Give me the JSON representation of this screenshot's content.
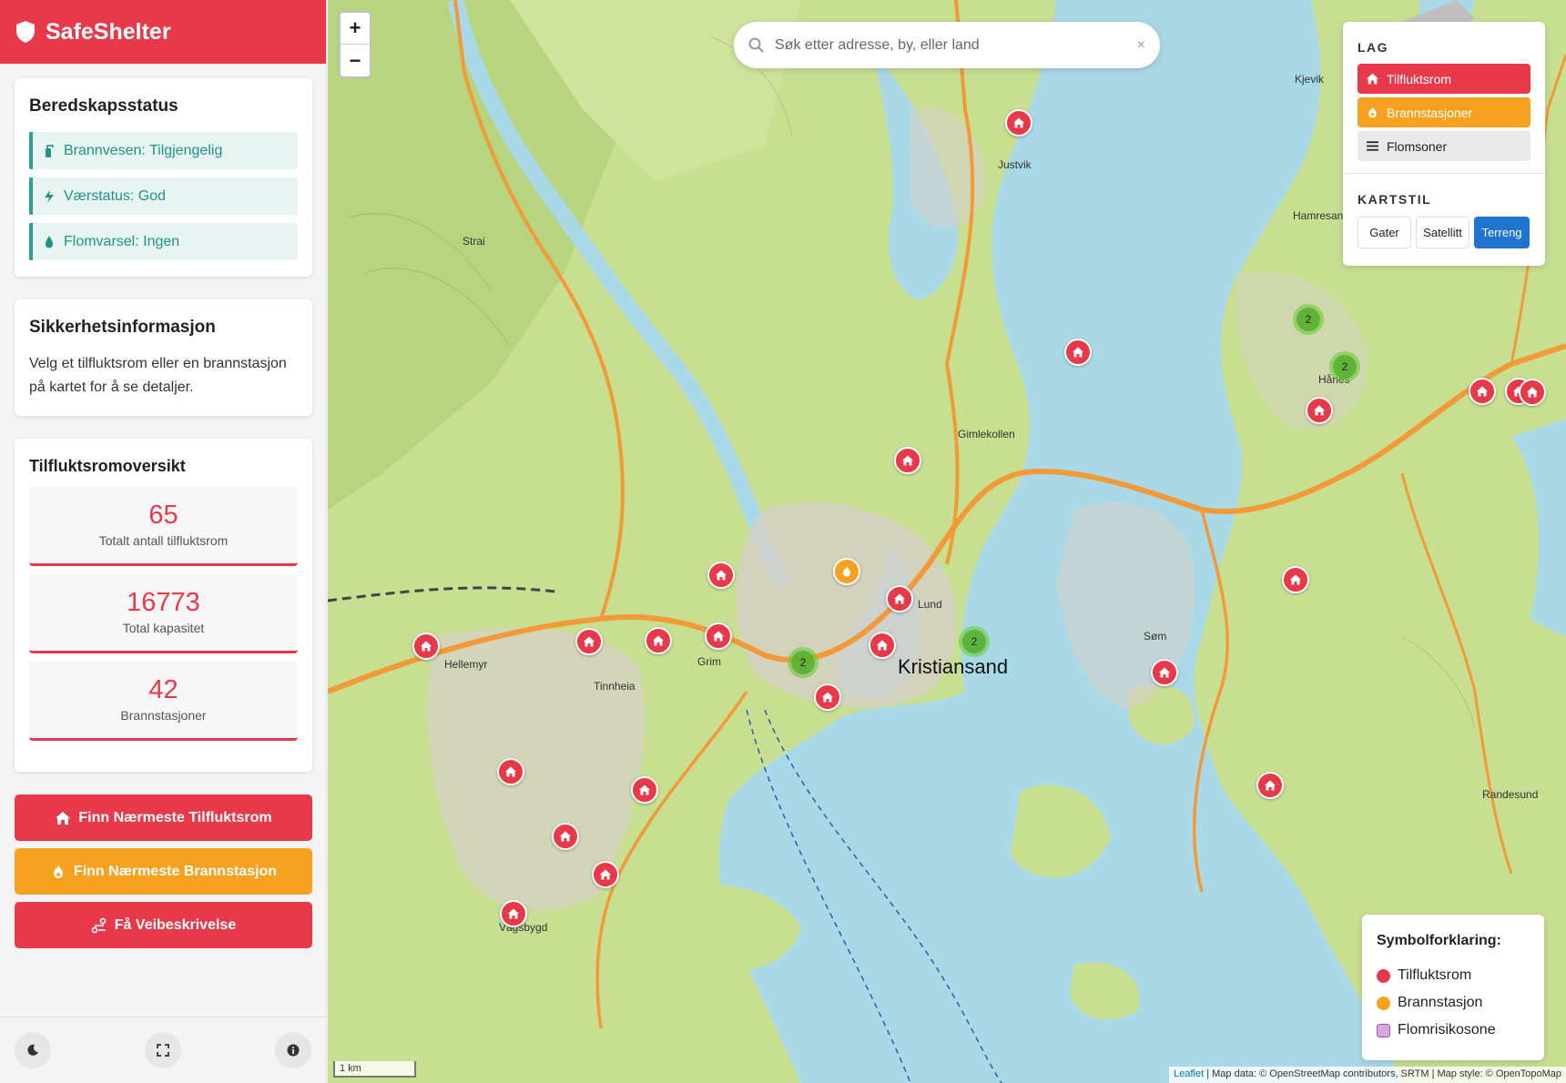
{
  "app": {
    "name": "SafeShelter"
  },
  "status": {
    "title": "Beredskapsstatus",
    "items": [
      {
        "icon": "fire-extinguisher-icon",
        "text": "Brannvesen: Tilgjengelig"
      },
      {
        "icon": "bolt-icon",
        "text": "Værstatus: God"
      },
      {
        "icon": "droplet-icon",
        "text": "Flomvarsel: Ingen"
      }
    ]
  },
  "info": {
    "title": "Sikkerhetsinformasjon",
    "text": "Velg et tilfluktsrom eller en brannstasjon på kartet for å se detaljer."
  },
  "overview": {
    "title": "Tilfluktsromoversikt",
    "stats": [
      {
        "value": "65",
        "label": "Totalt antall tilfluktsrom"
      },
      {
        "value": "16773",
        "label": "Total kapasitet"
      },
      {
        "value": "42",
        "label": "Brannstasjoner"
      }
    ]
  },
  "actions": {
    "shelter": "Finn Nærmeste Tilfluktsrom",
    "fire": "Finn Nærmeste Brannstasjon",
    "route": "Få Veibeskrivelse"
  },
  "footer": {
    "icons": [
      "moon-icon",
      "fullscreen-icon",
      "info-icon"
    ]
  },
  "map": {
    "zoom_in": "+",
    "zoom_out": "−",
    "search": {
      "placeholder": "Søk etter adresse, by, eller land",
      "clear": "×"
    },
    "layers": {
      "title": "LAG",
      "items": [
        "Tilfluktsrom",
        "Brannstasjoner",
        "Flomsoner"
      ],
      "style_title": "KARTSTIL",
      "styles": [
        "Gater",
        "Satellitt",
        "Terreng"
      ],
      "active_style": "Terreng"
    },
    "legend": {
      "title": "Symbolforklaring:",
      "items": [
        "Tilfluktsrom",
        "Brannstasjon",
        "Flomrisikosone"
      ]
    },
    "scale": "1 km",
    "attribution": {
      "leaflet": "Leaflet",
      "rest": " | Map data: © OpenStreetMap contributors, SRTM | Map style: © OpenTopoMap"
    },
    "places": [
      "Kristiansand",
      "Justvik",
      "Gimlekollen",
      "Lund",
      "Grim",
      "Hellemyr",
      "Tinnheia",
      "Vågsbygd",
      "Søm",
      "Hamresanden",
      "Kjevik",
      "Randesund",
      "Strai",
      "Hånes"
    ],
    "clusters": [
      "2",
      "2",
      "2",
      "2"
    ]
  },
  "colors": {
    "brand": "#e8394a",
    "fire": "#f7a121",
    "status": "#2aa198",
    "active_style": "#1f74d0",
    "water": "#a9d9e6",
    "land": "#c8df92"
  }
}
